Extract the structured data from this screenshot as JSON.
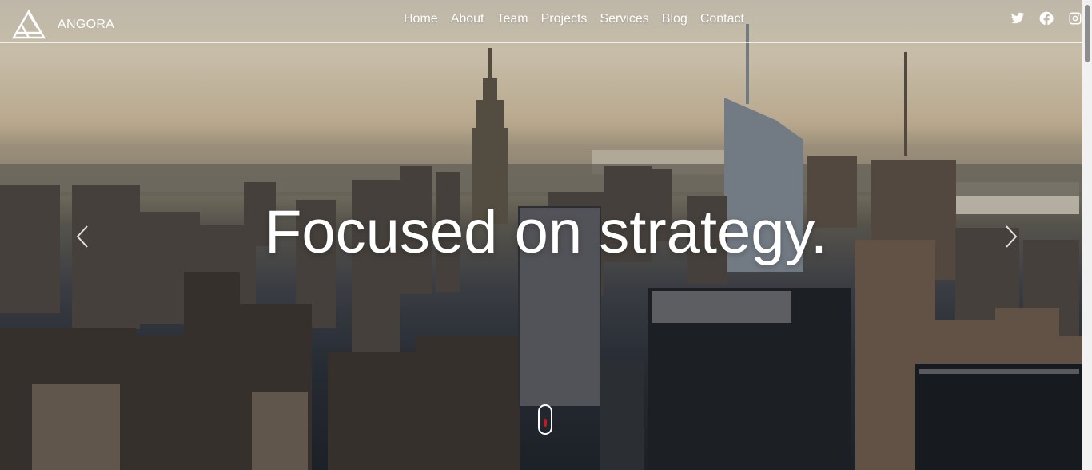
{
  "brand": {
    "name": "ANGORA",
    "logo_icon": "triangle-logo-icon"
  },
  "nav": {
    "items": [
      {
        "label": "Home"
      },
      {
        "label": "About"
      },
      {
        "label": "Team"
      },
      {
        "label": "Projects"
      },
      {
        "label": "Services"
      },
      {
        "label": "Blog"
      },
      {
        "label": "Contact"
      }
    ]
  },
  "social": [
    "twitter-icon",
    "facebook-icon",
    "instagram-icon"
  ],
  "hero": {
    "headline": "Focused on strategy.",
    "prev_icon": "chevron-left-icon",
    "next_icon": "chevron-right-icon",
    "scroll_icon": "mouse-scroll-icon"
  },
  "colors": {
    "text": "#ffffff",
    "scroll_dot": "#b3202a"
  }
}
